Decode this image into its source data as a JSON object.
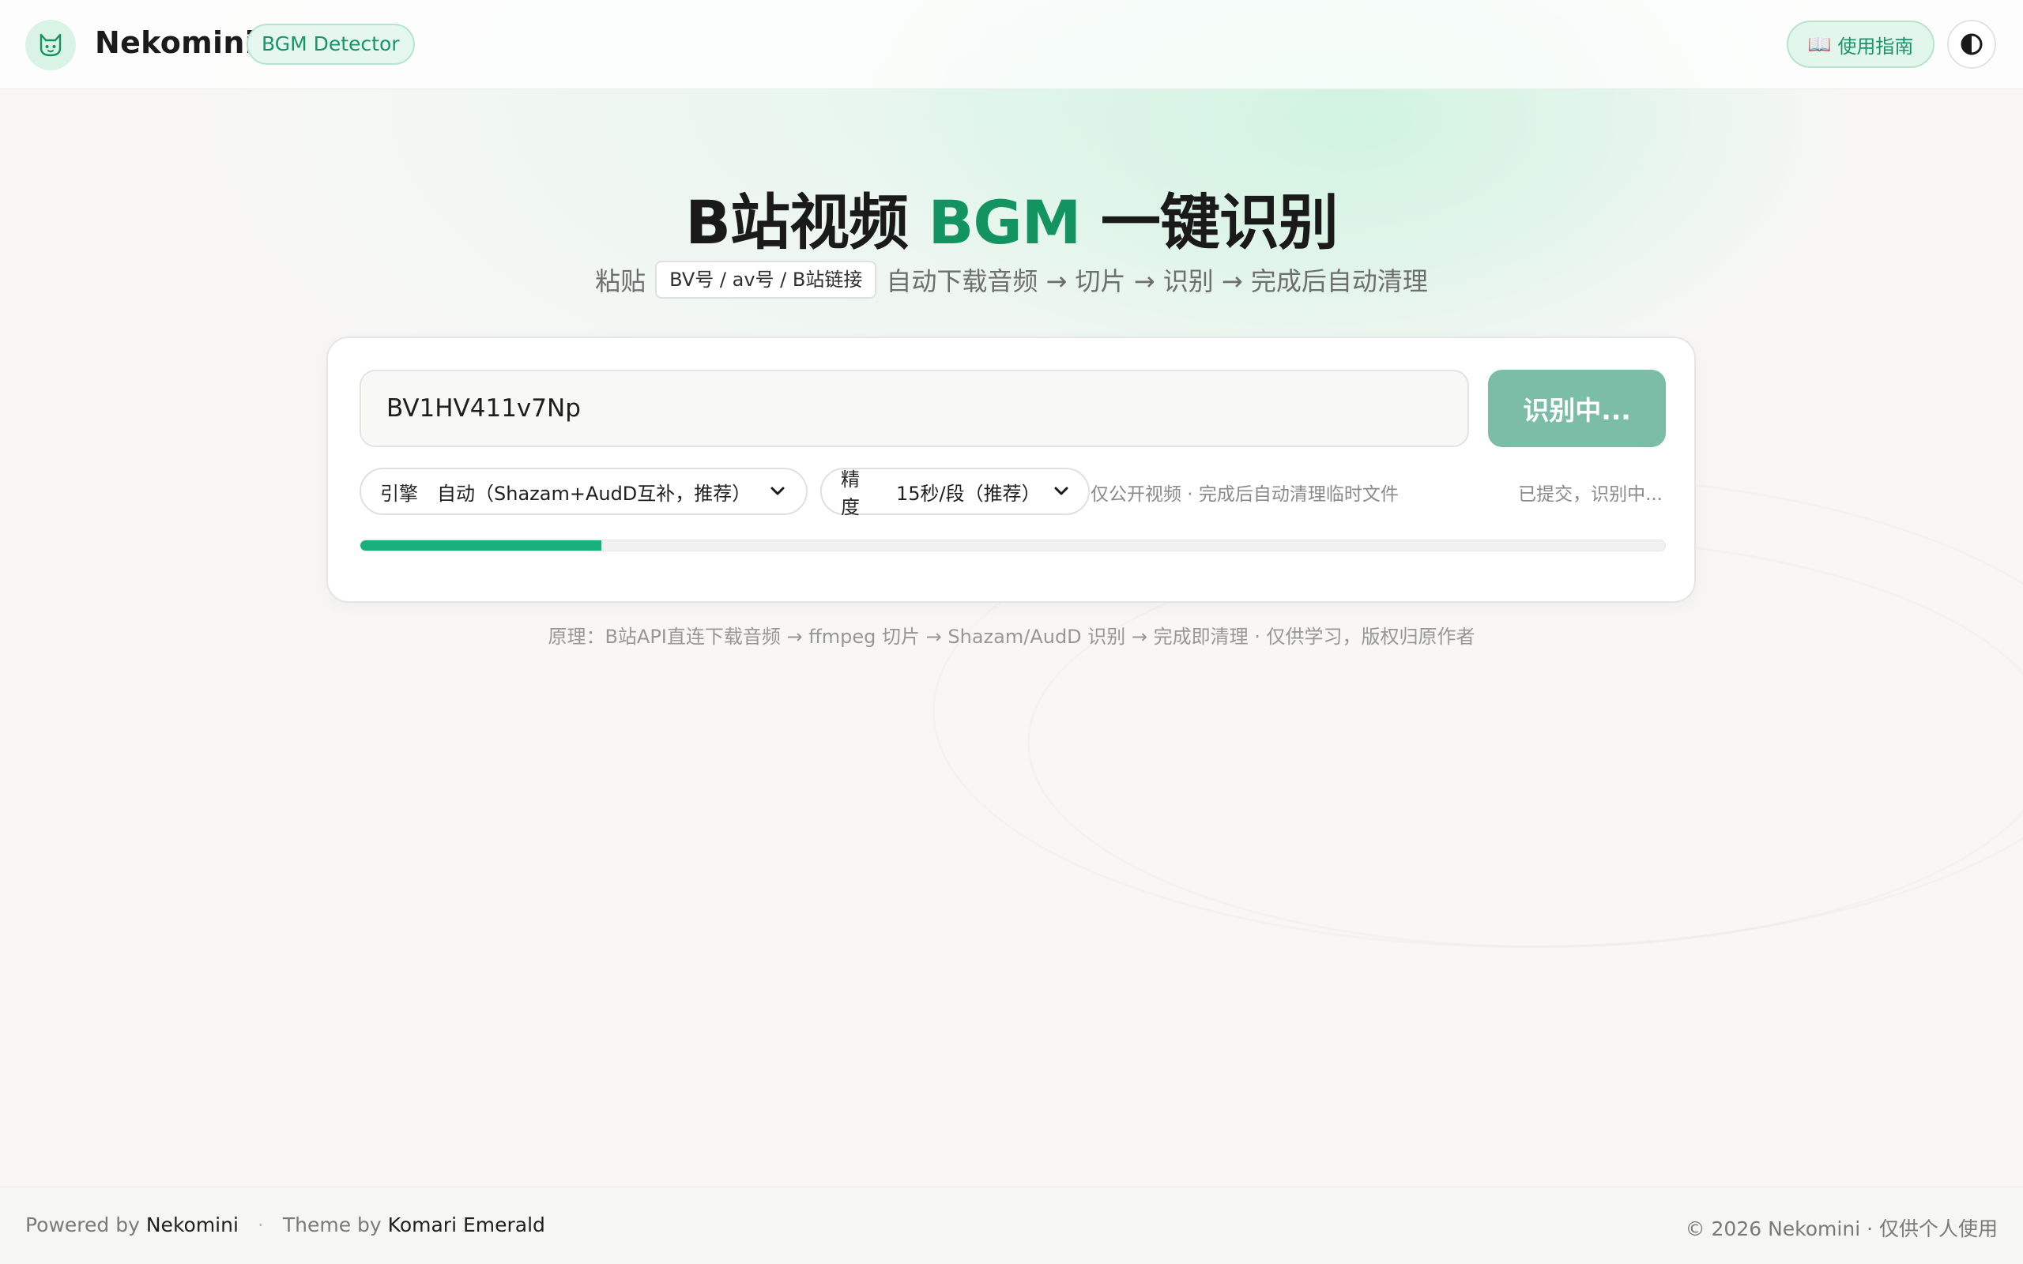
{
  "header": {
    "brand": "Nekomini",
    "tag": "BGM Detector",
    "guide_label": "使用指南",
    "guide_icon": "📖",
    "theme_toggle_icon": "contrast-icon"
  },
  "hero": {
    "title_pre": "B站视频",
    "title_accent": "BGM",
    "title_post": "一键识别",
    "sub_prefix": "粘贴",
    "sub_chip": "BV号 / av号 / B站链接",
    "sub_suffix": "自动下载音频 → 切片 → 识别 → 完成后自动清理"
  },
  "form": {
    "input_value": "BV1HV411v7Np",
    "submit_label": "识别中...",
    "engine_label": "引擎",
    "engine_value": "自动（Shazam+AudD互补，推荐）",
    "precision_label": "精度",
    "precision_value": "15秒/段（推荐）",
    "note": "仅公开视频 · 完成后自动清理临时文件",
    "status": "已提交，识别中...",
    "progress_fraction": 0.185
  },
  "principle": "原理：B站API直连下载音频 → ffmpeg 切片 → Shazam/AudD 识别 → 完成即清理 · 仅供学习，版权归原作者",
  "footer": {
    "powered_prefix": "Powered by",
    "powered_name": "Nekomini",
    "separator": "·",
    "theme_prefix": "Theme by",
    "theme_name": "Komari Emerald",
    "copyright": "© 2026 Nekomini · 仅供个人使用"
  },
  "colors": {
    "accent": "#13935f",
    "progress": "#18b07c",
    "submit_disabled": "#7bbda6"
  }
}
